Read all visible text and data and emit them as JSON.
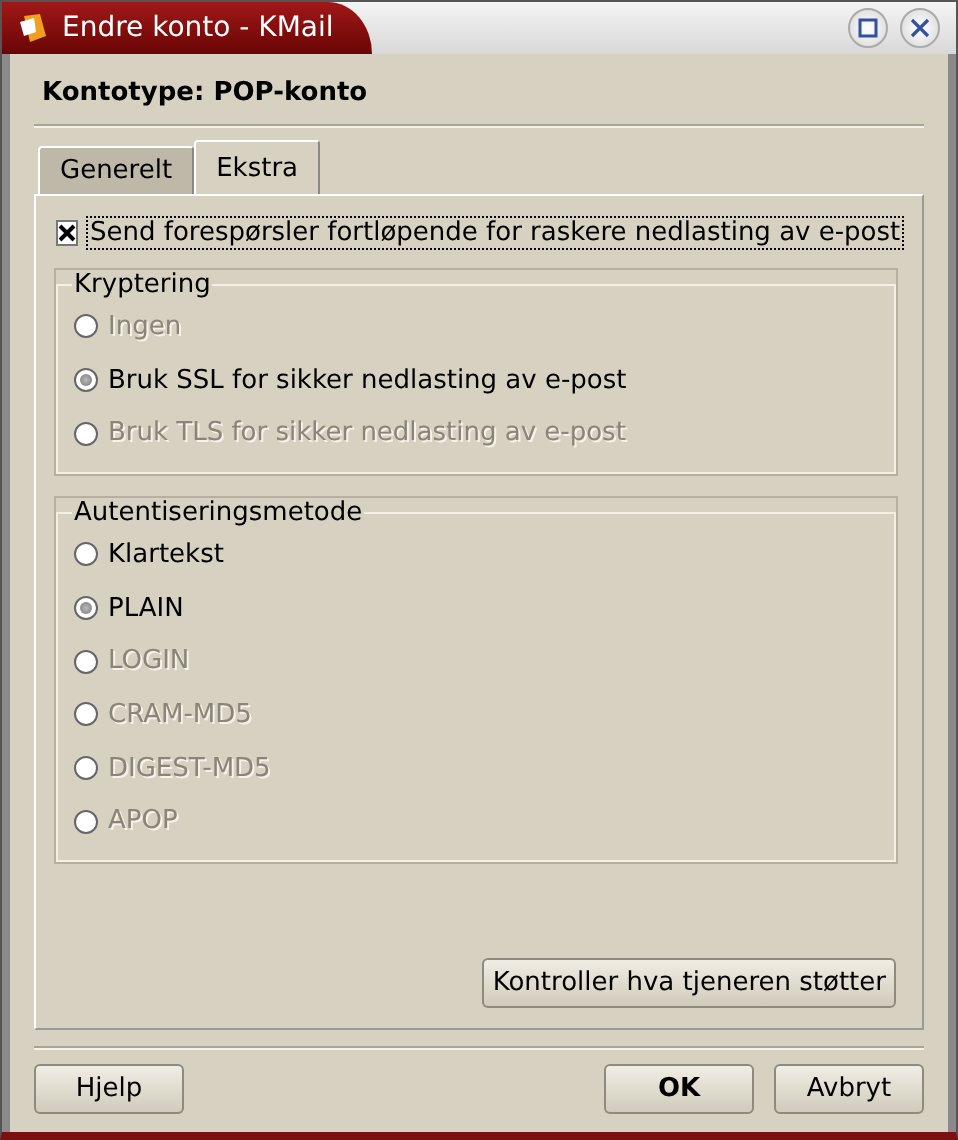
{
  "window": {
    "title": "Endre konto - KMail"
  },
  "heading": "Kontotype: POP-konto",
  "tabs": [
    {
      "label": "Generelt",
      "selected": false
    },
    {
      "label": "Ekstra",
      "selected": true
    }
  ],
  "pipelining": {
    "label": "Send forespørsler fortløpende for raskere nedlasting av e-post",
    "checked": true
  },
  "groups": [
    {
      "title": "Kryptering",
      "options": [
        {
          "label": "Ingen",
          "selected": false,
          "disabled": true
        },
        {
          "label": "Bruk SSL for sikker nedlasting av e-post",
          "selected": true,
          "disabled": false
        },
        {
          "label": "Bruk TLS for sikker nedlasting av e-post",
          "selected": false,
          "disabled": true
        }
      ]
    },
    {
      "title": "Autentiseringsmetode",
      "options": [
        {
          "label": "Klartekst",
          "selected": false,
          "disabled": false
        },
        {
          "label": "PLAIN",
          "selected": true,
          "disabled": false
        },
        {
          "label": "LOGIN",
          "selected": false,
          "disabled": true
        },
        {
          "label": "CRAM-MD5",
          "selected": false,
          "disabled": true
        },
        {
          "label": "DIGEST-MD5",
          "selected": false,
          "disabled": true
        },
        {
          "label": "APOP",
          "selected": false,
          "disabled": true
        }
      ]
    }
  ],
  "check_button": "Kontroller hva tjeneren støtter",
  "buttons": [
    {
      "label": "Hjelp",
      "default": false
    },
    {
      "label": "OK",
      "default": true
    },
    {
      "label": "Avbryt",
      "default": false
    }
  ]
}
